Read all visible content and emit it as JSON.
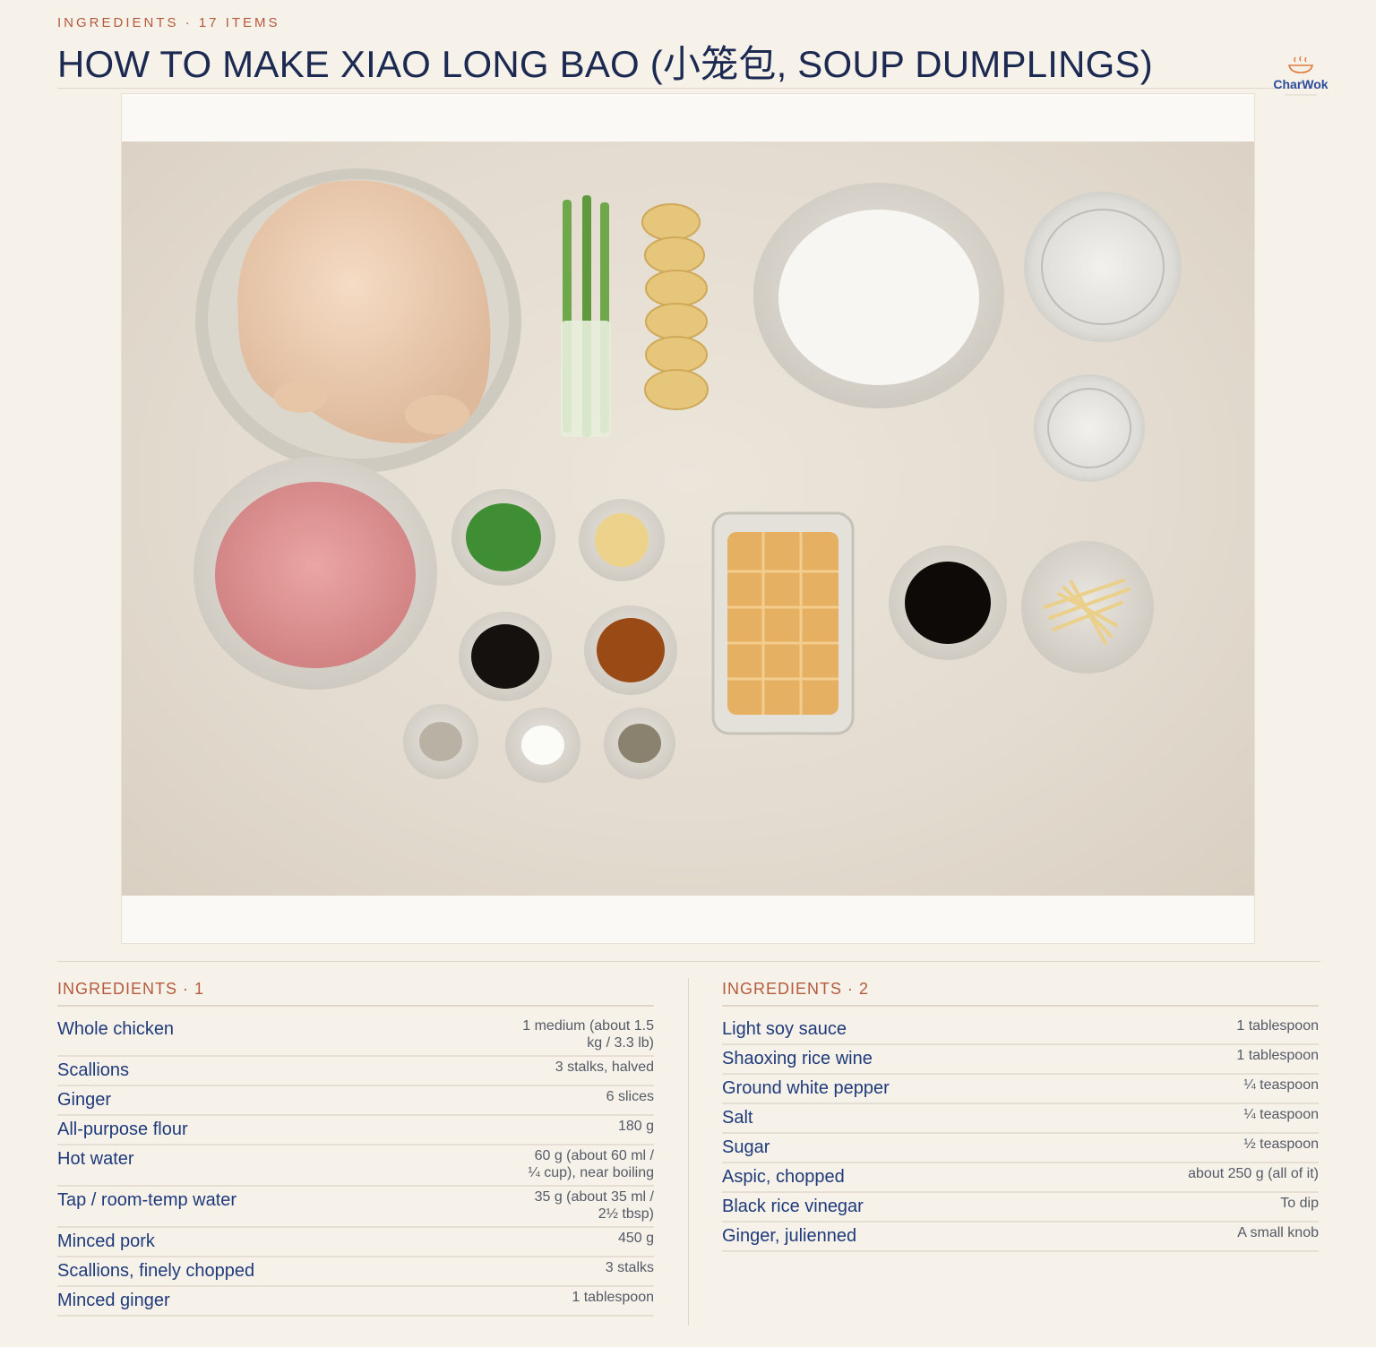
{
  "header": {
    "kicker": "INGREDIENTS · 17 ITEMS",
    "title": "HOW TO MAKE XIAO LONG BAO (小笼包, SOUP DUMPLINGS)"
  },
  "brand": {
    "name": "CharWok",
    "icon": "steaming-wok-icon",
    "accent": "#e07a3c",
    "color": "#2b4a9a"
  },
  "photo": {
    "alt": "Flat lay of xiao long bao ingredients"
  },
  "columns": [
    {
      "label": "INGREDIENTS",
      "number": "1",
      "items": [
        {
          "name": "Whole chicken",
          "qty": "1 medium (about 1.5 kg / 3.3 lb)"
        },
        {
          "name": "Scallions",
          "qty": "3 stalks, halved"
        },
        {
          "name": "Ginger",
          "qty": "6 slices"
        },
        {
          "name": "All-purpose flour",
          "qty": "180 g"
        },
        {
          "name": "Hot water",
          "qty": "60 g (about 60 ml / ¼ cup), near boiling"
        },
        {
          "name": "Tap / room-temp water",
          "qty": "35 g (about 35 ml / 2½ tbsp)"
        },
        {
          "name": "Minced pork",
          "qty": "450 g"
        },
        {
          "name": "Scallions, finely chopped",
          "qty": "3 stalks"
        },
        {
          "name": "Minced ginger",
          "qty": "1 tablespoon"
        }
      ]
    },
    {
      "label": "INGREDIENTS",
      "number": "2",
      "items": [
        {
          "name": "Light soy sauce",
          "qty": "1 tablespoon"
        },
        {
          "name": "Shaoxing rice wine",
          "qty": "1 tablespoon"
        },
        {
          "name": "Ground white pepper",
          "qty": "¼ teaspoon"
        },
        {
          "name": "Salt",
          "qty": "¼ teaspoon"
        },
        {
          "name": "Sugar",
          "qty": "½ teaspoon"
        },
        {
          "name": "Aspic, chopped",
          "qty": "about 250 g (all of it)"
        },
        {
          "name": "Black rice vinegar",
          "qty": "To dip"
        },
        {
          "name": "Ginger, julienned",
          "qty": "A small knob"
        }
      ]
    }
  ],
  "colors": {
    "accent": "#b55a3c",
    "ink": "#1f3a7a",
    "background": "#f6f2ea"
  }
}
